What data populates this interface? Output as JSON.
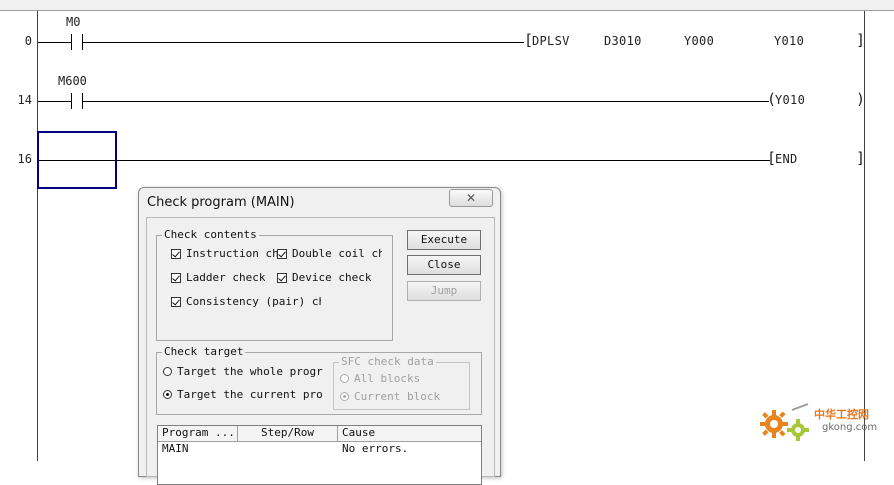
{
  "ladder": {
    "rungs": [
      {
        "step": "0",
        "contact": "M0",
        "instruction": "DPLSV",
        "operands": [
          "D3010",
          "Y000",
          "Y010"
        ]
      },
      {
        "step": "14",
        "contact": "M600",
        "coil": "Y010"
      },
      {
        "step": "16",
        "instruction": "END"
      }
    ]
  },
  "dialog": {
    "title": "Check program (MAIN)",
    "close_glyph": "✕",
    "check_contents": {
      "legend": "Check contents",
      "items": [
        {
          "label": "Instruction che",
          "checked": true
        },
        {
          "label": "Double coil ch",
          "checked": true
        },
        {
          "label": "Ladder check",
          "checked": true
        },
        {
          "label": "Device check",
          "checked": true
        },
        {
          "label": "Consistency (pair) ch",
          "checked": true
        }
      ]
    },
    "buttons": {
      "execute": "Execute",
      "close": "Close",
      "jump": "Jump"
    },
    "check_target": {
      "legend": "Check target",
      "whole": "Target the whole progr",
      "current": "Target the current pro",
      "selected": "current"
    },
    "sfc": {
      "legend": "SFC check data",
      "all_blocks": "All blocks",
      "current_block": "Current block",
      "selected": "current_block"
    },
    "results": {
      "headers": [
        "Program ...",
        "Step/Row",
        "Cause"
      ],
      "rows": [
        {
          "program": "MAIN",
          "step": "",
          "cause": "No errors."
        }
      ]
    }
  },
  "watermark": {
    "text": "中华工控网",
    "url": "gkong.com"
  },
  "colors": {
    "cursor": "#000080",
    "watermark": "#e8751a"
  }
}
